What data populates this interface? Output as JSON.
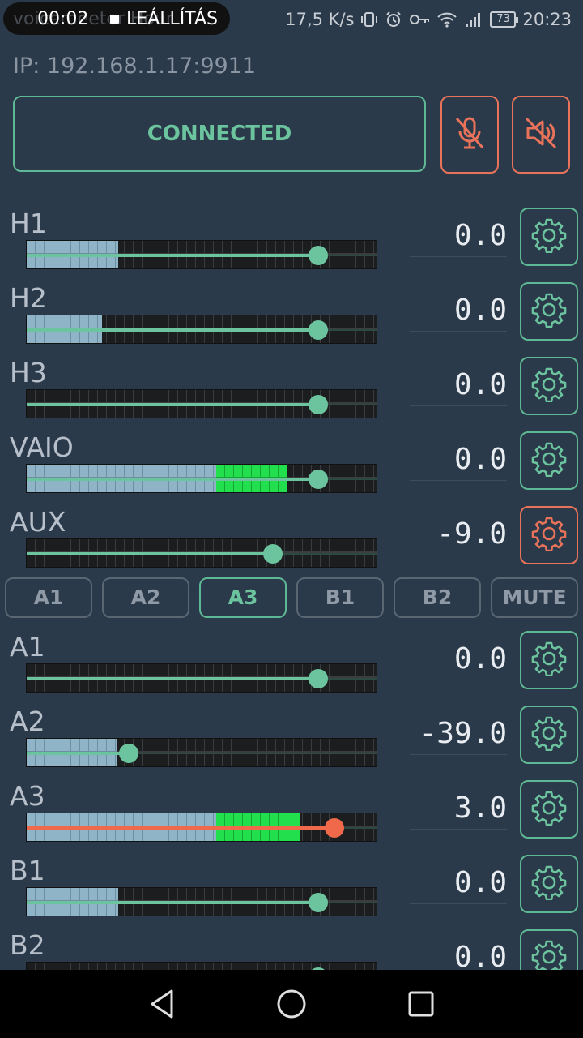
{
  "status_bar": {
    "rec_ghost_text": "voicemeeter Hour",
    "rec_time": "00:02",
    "rec_stop_label": "LEÁLLÍTÁS",
    "net_speed": "17,5 K/s",
    "battery": "73",
    "clock": "20:23"
  },
  "ip_label": "IP: 192.168.1.17:9911",
  "connection": {
    "status": "CONNECTED"
  },
  "colors": {
    "accent": "#6cc49f",
    "alert": "#e8735a",
    "background": "#2b3a4a",
    "meter_blue": "#8fb3c7",
    "meter_green": "#22e04d"
  },
  "inputs": [
    {
      "label": "H1",
      "value": "0.0",
      "fader": 0.83,
      "level_blue": 0.26,
      "level_green": 0,
      "alert": false
    },
    {
      "label": "H2",
      "value": "0.0",
      "fader": 0.83,
      "level_blue": 0.215,
      "level_green": 0,
      "alert": false
    },
    {
      "label": "H3",
      "value": "0.0",
      "fader": 0.83,
      "level_blue": 0,
      "level_green": 0,
      "alert": false
    },
    {
      "label": "VAIO",
      "value": "0.0",
      "fader": 0.83,
      "level_blue": 0.54,
      "level_green": 0.2,
      "alert": false
    },
    {
      "label": "AUX",
      "value": "-9.0",
      "fader": 0.7,
      "level_blue": 0,
      "level_green": 0,
      "alert": true
    }
  ],
  "bus_buttons": [
    {
      "label": "A1",
      "active": false
    },
    {
      "label": "A2",
      "active": false
    },
    {
      "label": "A3",
      "active": true
    },
    {
      "label": "B1",
      "active": false
    },
    {
      "label": "B2",
      "active": false
    },
    {
      "label": "MUTE",
      "active": false
    }
  ],
  "outputs": [
    {
      "label": "A1",
      "value": "0.0",
      "fader": 0.83,
      "level_blue": 0,
      "level_green": 0,
      "alert": false,
      "hot": false
    },
    {
      "label": "A2",
      "value": "-39.0",
      "fader": 0.29,
      "level_blue": 0.255,
      "level_green": 0,
      "alert": false,
      "hot": false
    },
    {
      "label": "A3",
      "value": "3.0",
      "fader": 0.875,
      "level_blue": 0.54,
      "level_green": 0.24,
      "alert": false,
      "hot": true
    },
    {
      "label": "B1",
      "value": "0.0",
      "fader": 0.83,
      "level_blue": 0.26,
      "level_green": 0,
      "alert": false,
      "hot": false
    },
    {
      "label": "B2",
      "value": "0.0",
      "fader": 0.83,
      "level_blue": 0,
      "level_green": 0,
      "alert": false,
      "hot": false
    }
  ],
  "icons": {
    "mic_mute": "mic-off-icon",
    "speaker_mute": "speaker-off-icon",
    "settings": "gear-icon",
    "nav_back": "back-triangle-icon",
    "nav_home": "home-circle-icon",
    "nav_recents": "recents-square-icon"
  }
}
